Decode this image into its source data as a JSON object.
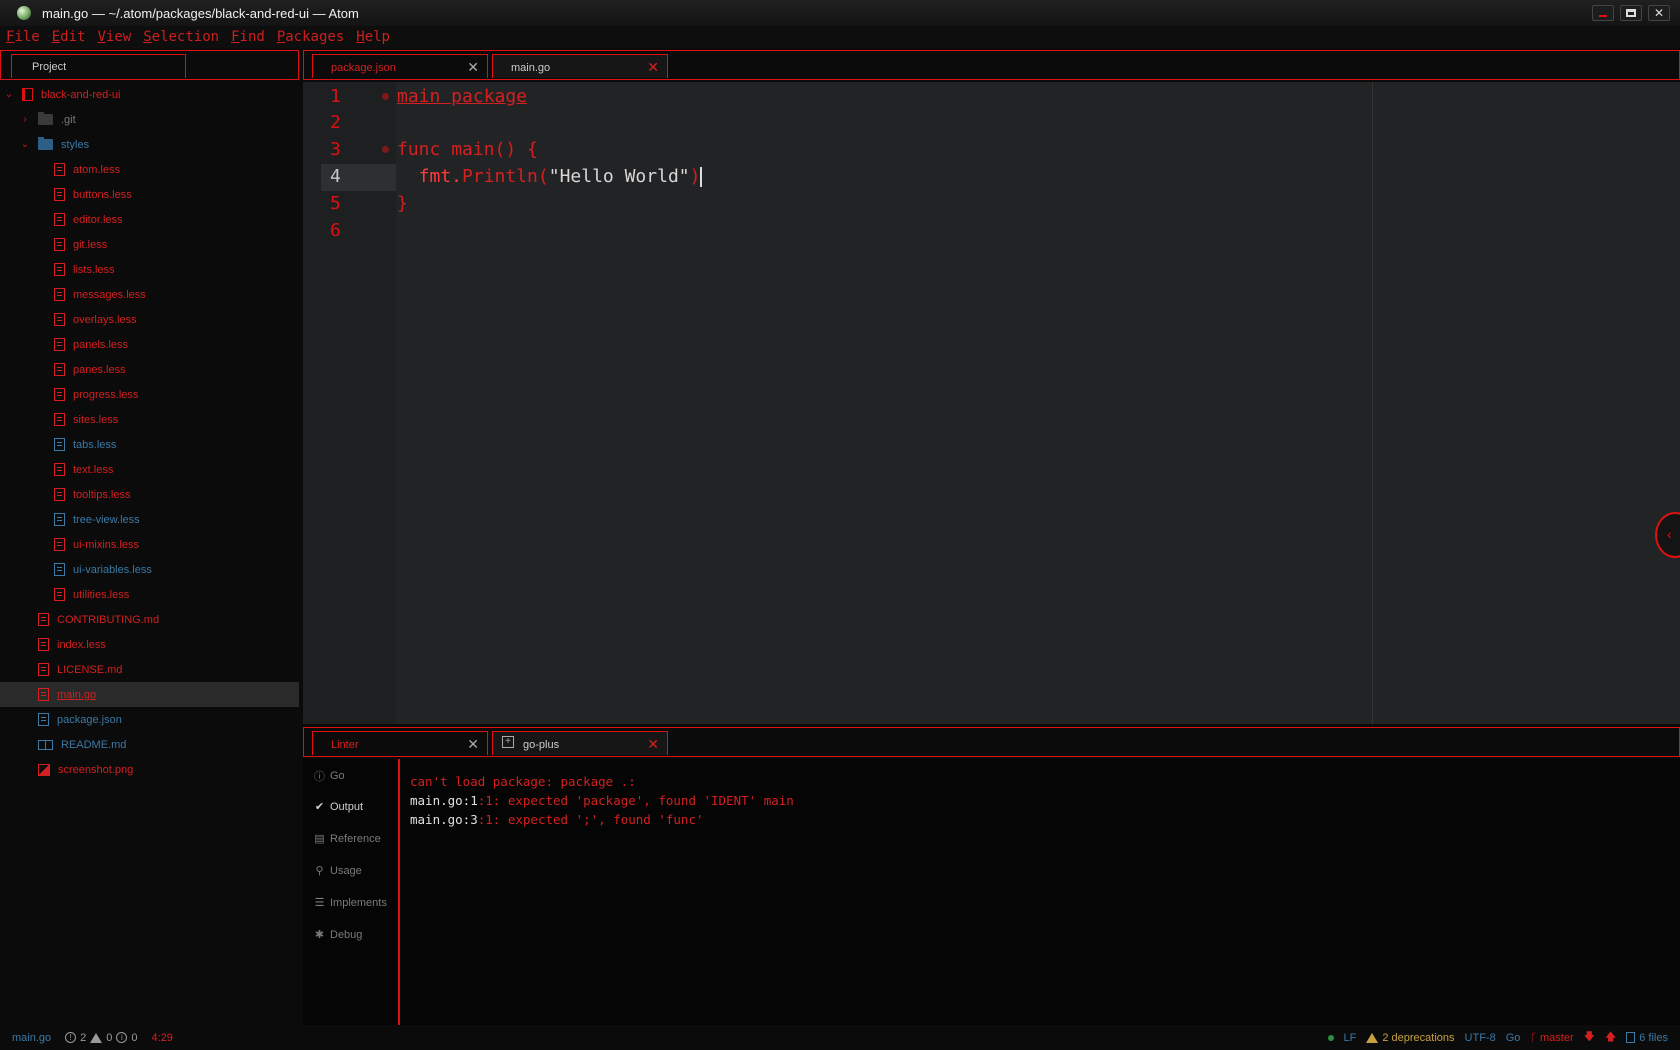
{
  "window": {
    "title": "main.go — ~/.atom/packages/black-and-red-ui — Atom",
    "close_glyph": "✕"
  },
  "menu": [
    {
      "first": "F",
      "rest": "ile"
    },
    {
      "first": "E",
      "rest": "dit"
    },
    {
      "first": "V",
      "rest": "iew"
    },
    {
      "first": "S",
      "rest": "election"
    },
    {
      "first": "F",
      "rest": "ind"
    },
    {
      "first": "P",
      "rest": "ackages"
    },
    {
      "first": "H",
      "rest": "elp"
    }
  ],
  "tree": {
    "tab_label": "Project",
    "root": "black-and-red-ui",
    "items": [
      {
        "label": ".git",
        "type": "folder",
        "collapsed": true
      },
      {
        "label": "styles",
        "type": "folder",
        "collapsed": false
      },
      {
        "label": "atom.less"
      },
      {
        "label": "buttons.less"
      },
      {
        "label": "editor.less"
      },
      {
        "label": "git.less"
      },
      {
        "label": "lists.less"
      },
      {
        "label": "messages.less"
      },
      {
        "label": "overlays.less"
      },
      {
        "label": "panels.less"
      },
      {
        "label": "panes.less"
      },
      {
        "label": "progress.less"
      },
      {
        "label": "sites.less"
      },
      {
        "label": "tabs.less"
      },
      {
        "label": "text.less"
      },
      {
        "label": "tooltips.less"
      },
      {
        "label": "tree-view.less"
      },
      {
        "label": "ui-mixins.less"
      },
      {
        "label": "ui-variables.less"
      },
      {
        "label": "utilities.less"
      },
      {
        "label": "CONTRIBUTING.md"
      },
      {
        "label": "index.less"
      },
      {
        "label": "LICENSE.md"
      },
      {
        "label": "main.go",
        "selected": true
      },
      {
        "label": "package.json"
      },
      {
        "label": "README.md"
      },
      {
        "label": "screenshot.png"
      }
    ]
  },
  "editor_tabs": [
    {
      "label": "package.json",
      "close": "✕"
    },
    {
      "label": "main.go",
      "close": "✕",
      "active": true
    }
  ],
  "editor": {
    "line_numbers": [
      "1",
      "2",
      "3",
      "4",
      "5",
      "6"
    ],
    "lines": {
      "l1": "main package",
      "l3_kw": "func",
      "l3_rest": " main() {",
      "l4_a": "  fmt.",
      "l4_b": "Println(",
      "l4_str": "\"Hello World\"",
      "l4_c": ")",
      "l5": "}"
    },
    "side_toggle": "‹"
  },
  "dock_tabs": [
    {
      "label": "Linter",
      "close": "✕"
    },
    {
      "label": "go-plus",
      "close": "✕",
      "active": true
    }
  ],
  "dock_nav": [
    {
      "label": "Go",
      "icon": "info-icon",
      "glyph": "ⓘ"
    },
    {
      "label": "Output",
      "icon": "check-icon",
      "glyph": "✔",
      "active": true
    },
    {
      "label": "Reference",
      "icon": "book-icon",
      "glyph": "▤"
    },
    {
      "label": "Usage",
      "icon": "telescope-icon",
      "glyph": "⚲"
    },
    {
      "label": "Implements",
      "icon": "checklist-icon",
      "glyph": "☰"
    },
    {
      "label": "Debug",
      "icon": "bug-icon",
      "glyph": "✱"
    }
  ],
  "output": {
    "line1": "can't load package: package .:",
    "line2_w": "main.go:1",
    "line2_r": ":1: expected 'package', found 'IDENT' main",
    "line3_w": "main.go:3",
    "line3_r": ":1: expected ';', found 'func'"
  },
  "status": {
    "file": "main.go",
    "errors": "2",
    "warnings": "0",
    "infos": "0",
    "cursor": "4:29",
    "line_ending": "LF",
    "deprecations": "2 deprecations",
    "encoding": "UTF-8",
    "grammar": "Go",
    "branch": "master",
    "files": "6 files"
  }
}
